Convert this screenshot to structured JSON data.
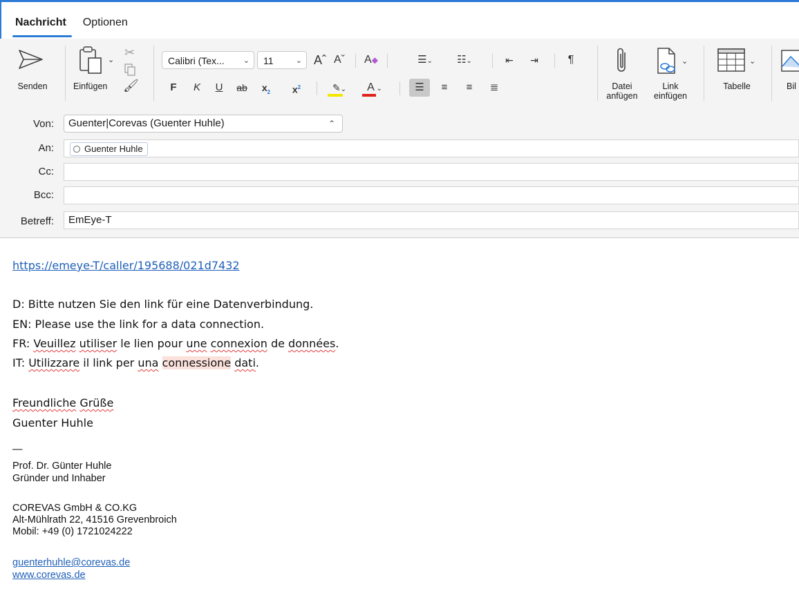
{
  "tabs": [
    {
      "label": "Nachricht",
      "active": true
    },
    {
      "label": "Optionen",
      "active": false
    }
  ],
  "ribbon": {
    "send_label": "Senden",
    "paste_label": "Einfügen",
    "font_name": "Calibri (Tex...",
    "font_size": "11",
    "bold": "F",
    "italic": "K",
    "underline": "U",
    "strike": "ab",
    "subscript": "x",
    "superscript": "x",
    "attach_file_line1": "Datei",
    "attach_file_line2": "anfügen",
    "insert_link_line1": "Link",
    "insert_link_line2": "einfügen",
    "table_label": "Tabelle",
    "picture_label": "Bil",
    "highlight_color": "#f5e600",
    "font_color": "#e0201c"
  },
  "header": {
    "from_label": "Von:",
    "from_value": "Guenter|Corevas (Guenter Huhle)",
    "to_label": "An:",
    "to_recipient": "Guenter Huhle",
    "cc_label": "Cc:",
    "cc_value": "",
    "bcc_label": "Bcc:",
    "bcc_value": "",
    "subject_label": "Betreff:",
    "subject_value": "EmEye-T"
  },
  "body": {
    "link": "https://emeye-T/caller/195688/021d7432",
    "line_de": "D: Bitte nutzen Sie den link für eine Datenverbindung.",
    "line_en": "EN: Please use the link for a data connection.",
    "line_fr": {
      "prefix": "FR: ",
      "w1": "Veuillez",
      "s1": " ",
      "w2": "utiliser",
      "s2": " le lien pour ",
      "w3": "une",
      "s3": " ",
      "w4": "connexion",
      "s4": " de ",
      "w5": "données",
      "suffix": "."
    },
    "line_it": {
      "prefix": "IT: ",
      "w1": "Utilizzare",
      "s1": " il link per ",
      "w2": "una",
      "s2": " ",
      "w3": "connessione",
      "s3": " ",
      "w4": "dati",
      "suffix": "."
    },
    "greeting_w1": "Freundliche",
    "greeting_w2": "Grüße",
    "name": "Guenter Huhle"
  },
  "signature": {
    "dash": "—",
    "title": "Prof. Dr. Günter Huhle",
    "role": "Gründer und Inhaber",
    "company": "COREVAS GmbH & CO.KG",
    "address": "Alt-Mühlrath 22, 41516 Grevenbroich",
    "mobile": "Mobil: +49 (0) 1721024222",
    "email": "guenterhuhle@corevas.de",
    "website": "www.corevas.de"
  }
}
